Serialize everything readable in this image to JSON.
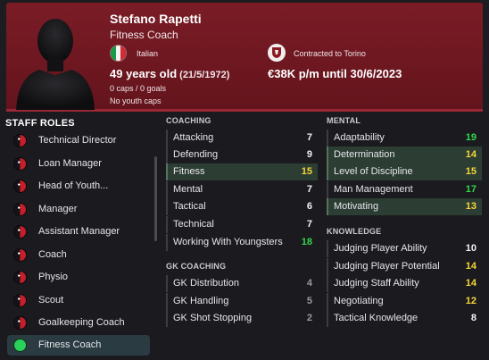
{
  "person": {
    "name": "Stefano Rapetti",
    "role": "Fitness Coach",
    "nationality": "Italian",
    "age": "49 years old",
    "dob": "(21/5/1972)",
    "caps": "0 caps / 0 goals",
    "youth_caps": "No youth caps",
    "contract": "Contracted to Torino",
    "wage": "€38K p/m until 30/6/2023"
  },
  "colors": {
    "header_bg": "#6d1720",
    "accent": "#9a2734",
    "active_role": "#2a3b42",
    "highlight_row": "#2c3d34",
    "value_green": "#32d74b",
    "value_yellow": "#f5d437"
  },
  "staff_roles": {
    "title": "STAFF ROLES",
    "items": [
      {
        "label": "Technical Director",
        "icon": "role-indicator-icon",
        "active": false
      },
      {
        "label": "Loan Manager",
        "icon": "role-indicator-icon",
        "active": false
      },
      {
        "label": "Head of Youth...",
        "icon": "role-indicator-icon",
        "active": false
      },
      {
        "label": "Manager",
        "icon": "role-indicator-icon",
        "active": false
      },
      {
        "label": "Assistant Manager",
        "icon": "role-indicator-icon",
        "active": false
      },
      {
        "label": "Coach",
        "icon": "role-indicator-icon",
        "active": false
      },
      {
        "label": "Physio",
        "icon": "role-indicator-icon",
        "active": false
      },
      {
        "label": "Scout",
        "icon": "role-indicator-icon",
        "active": false
      },
      {
        "label": "Goalkeeping Coach",
        "icon": "role-indicator-icon",
        "active": false
      },
      {
        "label": "Fitness Coach",
        "icon": "role-indicator-icon",
        "active": true
      }
    ]
  },
  "coaching": {
    "title": "COACHING",
    "attrs": [
      {
        "name": "Attacking",
        "value": "7"
      },
      {
        "name": "Defending",
        "value": "9"
      },
      {
        "name": "Fitness",
        "value": "15"
      },
      {
        "name": "Mental",
        "value": "7"
      },
      {
        "name": "Tactical",
        "value": "6"
      },
      {
        "name": "Technical",
        "value": "7"
      },
      {
        "name": "Working With Youngsters",
        "value": "18"
      }
    ]
  },
  "gk_coaching": {
    "title": "GK COACHING",
    "attrs": [
      {
        "name": "GK Distribution",
        "value": "4"
      },
      {
        "name": "GK Handling",
        "value": "5"
      },
      {
        "name": "GK Shot Stopping",
        "value": "2"
      }
    ]
  },
  "mental": {
    "title": "MENTAL",
    "attrs": [
      {
        "name": "Adaptability",
        "value": "19"
      },
      {
        "name": "Determination",
        "value": "14"
      },
      {
        "name": "Level of Discipline",
        "value": "15"
      },
      {
        "name": "Man Management",
        "value": "17"
      },
      {
        "name": "Motivating",
        "value": "13"
      }
    ]
  },
  "knowledge": {
    "title": "KNOWLEDGE",
    "attrs": [
      {
        "name": "Judging Player Ability",
        "value": "10"
      },
      {
        "name": "Judging Player Potential",
        "value": "14"
      },
      {
        "name": "Judging Staff Ability",
        "value": "14"
      },
      {
        "name": "Negotiating",
        "value": "12"
      },
      {
        "name": "Tactical Knowledge",
        "value": "8"
      }
    ]
  }
}
